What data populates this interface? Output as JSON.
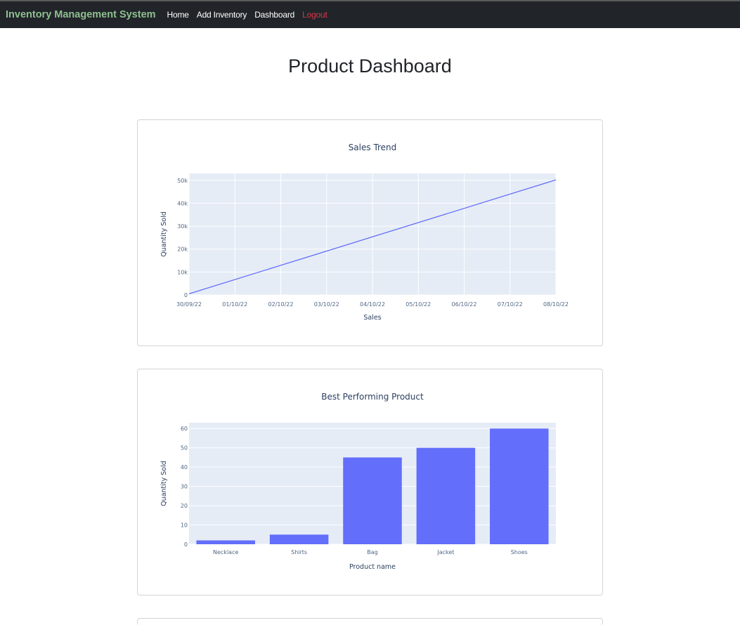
{
  "navbar": {
    "brand": "Inventory Management System",
    "links": [
      {
        "label": "Home"
      },
      {
        "label": "Add Inventory"
      },
      {
        "label": "Dashboard"
      },
      {
        "label": "Logout"
      }
    ],
    "colors": {
      "bg": "#212529",
      "brand": "#8fbf8f",
      "logout": "#dc3545"
    }
  },
  "page": {
    "title": "Product Dashboard"
  },
  "chart_data": [
    {
      "type": "line",
      "title": "Sales Trend",
      "xlabel": "Sales",
      "ylabel": "Quantity Sold",
      "x": [
        "30/09/22",
        "08/10/22"
      ],
      "y": [
        500,
        50200
      ],
      "xticks": [
        "30/09/22",
        "01/10/22",
        "02/10/22",
        "03/10/22",
        "04/10/22",
        "05/10/22",
        "06/10/22",
        "07/10/22",
        "08/10/22"
      ],
      "yticks": [
        0,
        10000,
        20000,
        30000,
        40000,
        50000
      ],
      "ytick_labels": [
        "0",
        "10k",
        "20k",
        "30k",
        "40k",
        "50k"
      ],
      "ylim": [
        0,
        53000
      ],
      "grid": true,
      "line_color": "#636efa",
      "plot_bg": "#e5ecf6"
    },
    {
      "type": "bar",
      "title": "Best Performing Product",
      "xlabel": "Product name",
      "ylabel": "Quantity Sold",
      "categories": [
        "Necklace",
        "Shirts",
        "Bag",
        "Jacket",
        "Shoes"
      ],
      "values": [
        2,
        5,
        45,
        50,
        60
      ],
      "yticks": [
        0,
        10,
        20,
        30,
        40,
        50,
        60
      ],
      "ylim": [
        0,
        63
      ],
      "grid": true,
      "bar_color": "#636efa",
      "plot_bg": "#e5ecf6"
    }
  ]
}
